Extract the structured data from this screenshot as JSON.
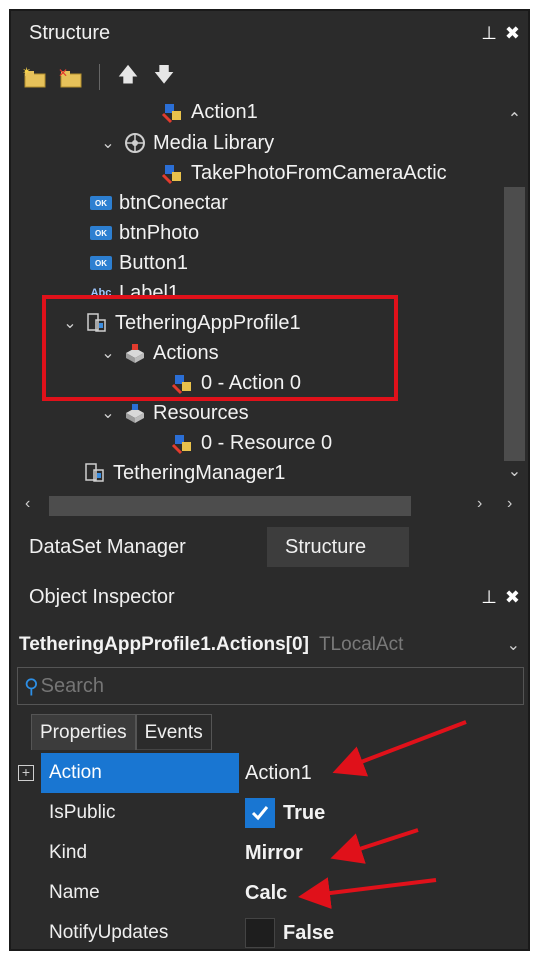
{
  "structure": {
    "title": "Structure",
    "tree": [
      {
        "label": "Action1",
        "level": 2,
        "icon": "action-icon",
        "chevron": ""
      },
      {
        "label": "Media Library",
        "level": 1,
        "icon": "media-library-icon",
        "chevron": "⌄"
      },
      {
        "label": "TakePhotoFromCameraActic",
        "level": 2,
        "icon": "action-icon",
        "chevron": ""
      },
      {
        "label": "btnConectar",
        "level": 0,
        "icon": "button-icon",
        "chevron": ""
      },
      {
        "label": "btnPhoto",
        "level": 0,
        "icon": "button-icon",
        "chevron": ""
      },
      {
        "label": "Button1",
        "level": 0,
        "icon": "button-icon",
        "chevron": ""
      },
      {
        "label": "Label1",
        "level": 0,
        "icon": "label-icon",
        "chevron": ""
      },
      {
        "label": "TetheringAppProfile1",
        "level": 0,
        "icon": "app-profile-icon",
        "chevron": "⌄"
      },
      {
        "label": "Actions",
        "level": 1,
        "icon": "actions-folder-icon",
        "chevron": "⌄"
      },
      {
        "label": "0 - Action 0",
        "level": 2,
        "icon": "action-icon",
        "chevron": ""
      },
      {
        "label": "Resources",
        "level": 1,
        "icon": "resources-folder-icon",
        "chevron": "⌄"
      },
      {
        "label": "0 - Resource 0",
        "level": 2,
        "icon": "resource-icon",
        "chevron": ""
      },
      {
        "label": "TetheringManager1",
        "level": 0,
        "icon": "tethering-manager-icon",
        "chevron": ""
      }
    ]
  },
  "bottom_tabs": [
    "DataSet Manager",
    "Structure"
  ],
  "inspector": {
    "title": "Object Inspector",
    "selected_object": "TetheringAppProfile1.Actions[0]",
    "selected_type": "TLocalAct",
    "search_placeholder": "Search",
    "tabs": [
      "Properties",
      "Events"
    ],
    "properties": [
      {
        "name": "Action",
        "value": "Action1",
        "bold": false,
        "checkbox": null
      },
      {
        "name": "IsPublic",
        "value": "True",
        "bold": true,
        "checkbox": true
      },
      {
        "name": "Kind",
        "value": "Mirror",
        "bold": true,
        "checkbox": null
      },
      {
        "name": "Name",
        "value": "Calc",
        "bold": true,
        "checkbox": null
      },
      {
        "name": "NotifyUpdates",
        "value": "False",
        "bold": true,
        "checkbox": false
      }
    ]
  },
  "colors": {
    "background": "#2b2b2b",
    "selection": "#1976d2",
    "highlight_box": "#e0111a",
    "annotation_arrow": "#e0111a"
  }
}
